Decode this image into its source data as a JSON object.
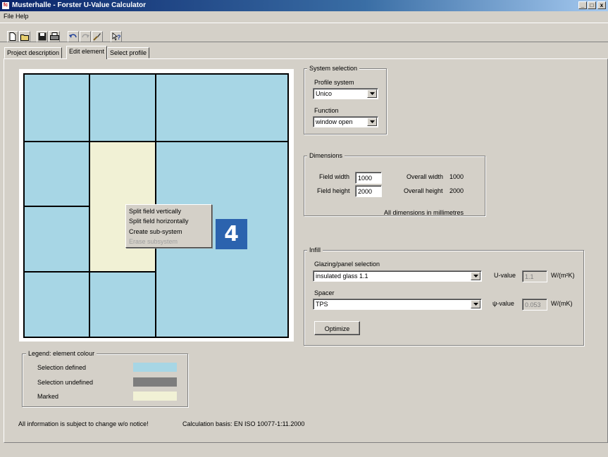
{
  "window": {
    "title": "Musterhalle - Forster U-Value Calculator",
    "app_icon_text": "fc",
    "min_glyph": "_",
    "max_glyph": "□",
    "close_glyph": "x"
  },
  "menu": {
    "items": [
      "File",
      "Help"
    ]
  },
  "toolbar": {
    "buttons": [
      "new-document-icon",
      "open-folder-icon",
      "save-icon",
      "print-icon",
      "undo-icon",
      "redo-icon",
      "brush-icon",
      "help-pointer-icon"
    ]
  },
  "tabs": [
    {
      "label": "Project description",
      "active": false
    },
    {
      "label": "Edit element",
      "active": true
    },
    {
      "label": "Select profile",
      "active": false
    }
  ],
  "canvas": {
    "colors": {
      "defined": "#a7d6e5",
      "undefined": "#7d7d7d",
      "marked": "#f1f1d5"
    }
  },
  "context_menu": {
    "items": [
      {
        "label": "Split field vertically",
        "enabled": true
      },
      {
        "label": "Split field horizontally",
        "enabled": true
      },
      {
        "label": "Create sub-system",
        "enabled": true
      },
      {
        "label": "Erase subsystem",
        "enabled": false
      }
    ]
  },
  "step_badge": "4",
  "system_selection": {
    "title": "System selection",
    "profile_label": "Profile system",
    "profile_value": "Unico",
    "function_label": "Function",
    "function_value": "window open"
  },
  "dimensions": {
    "title": "Dimensions",
    "field_width_label": "Field width",
    "field_width_value": "1000",
    "field_height_label": "Field height",
    "field_height_value": "2000",
    "overall_width_label": "Overall width",
    "overall_width_value": "1000",
    "overall_height_label": "Overall height",
    "overall_height_value": "2000",
    "note": "All dimensions in millimetres"
  },
  "infill": {
    "title": "Infill",
    "glazing_label": "Glazing/panel selection",
    "glazing_value": "insulated glass 1.1",
    "u_label": "U-value",
    "u_value": "1.1",
    "u_unit": "W/(m²K)",
    "spacer_label": "Spacer",
    "spacer_value": "TPS",
    "psi_label": "ψ-value",
    "psi_value": "0.053",
    "psi_unit": "W/(mK)",
    "optimize_label": "Optimize"
  },
  "legend": {
    "title": "Legend: element colour",
    "items": [
      {
        "label": "Selection defined",
        "color": "#a7d6e5"
      },
      {
        "label": "Selection undefined",
        "color": "#7d7d7d"
      },
      {
        "label": "Marked",
        "color": "#f1f1d5"
      }
    ]
  },
  "footer": {
    "notice": "All information is subject to change w/o notice!",
    "basis": "Calculation basis: EN ISO 10077-1:11.2000"
  }
}
